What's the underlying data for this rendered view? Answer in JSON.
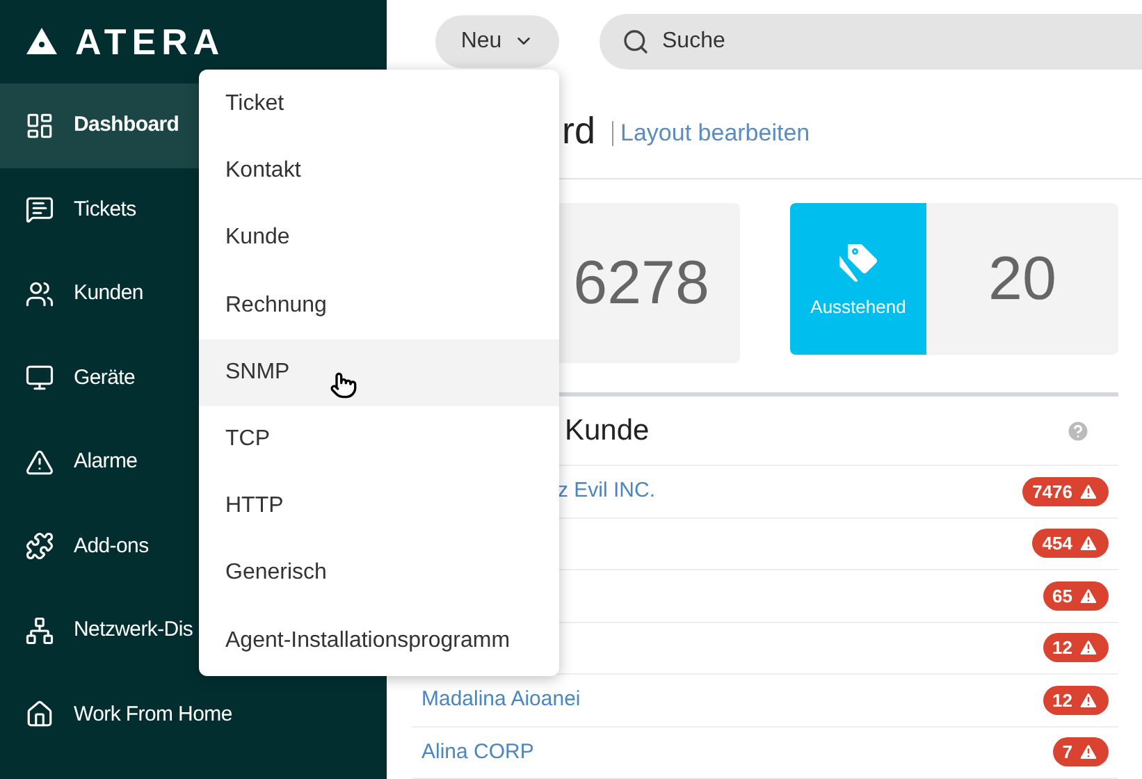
{
  "logo": "ATERA",
  "sidebar": {
    "items": [
      {
        "label": "Dashboard",
        "selected": true
      },
      {
        "label": "Tickets",
        "selected": false
      },
      {
        "label": "Kunden",
        "selected": false
      },
      {
        "label": "Geräte",
        "selected": false
      },
      {
        "label": "Alarme",
        "selected": false
      },
      {
        "label": "Add-ons",
        "selected": false
      },
      {
        "label": "Netzwerk-Dis",
        "selected": false
      },
      {
        "label": "Work From Home",
        "selected": false
      }
    ]
  },
  "topbar": {
    "new_button": "Neu",
    "search": {
      "placeholder": "Suche"
    }
  },
  "new_menu": {
    "items": [
      {
        "label": "Ticket",
        "selected": false
      },
      {
        "label": "Kontakt",
        "selected": false
      },
      {
        "label": "Kunde",
        "selected": false
      },
      {
        "label": "Rechnung",
        "selected": false
      },
      {
        "label": "SNMP",
        "selected": true
      },
      {
        "label": "TCP",
        "selected": false
      },
      {
        "label": "HTTP",
        "selected": false
      },
      {
        "label": "Generisch",
        "selected": false
      },
      {
        "label": "Agent-Installationsprogramm",
        "selected": false
      }
    ]
  },
  "header": {
    "title": "rd",
    "link": "Layout bearbeiten"
  },
  "stats": [
    {
      "value": "6278"
    },
    {
      "label": "Ausstehend",
      "value": "20"
    }
  ],
  "widget": {
    "title": "Kunde",
    "rows": [
      {
        "name": "z Evil INC.",
        "count": "7476"
      },
      {
        "count": "454"
      },
      {
        "count": "65"
      },
      {
        "count": "12"
      },
      {
        "name": "Madalina Aioanei",
        "count": "12"
      },
      {
        "name": "Alina CORP",
        "count": "7"
      }
    ]
  }
}
